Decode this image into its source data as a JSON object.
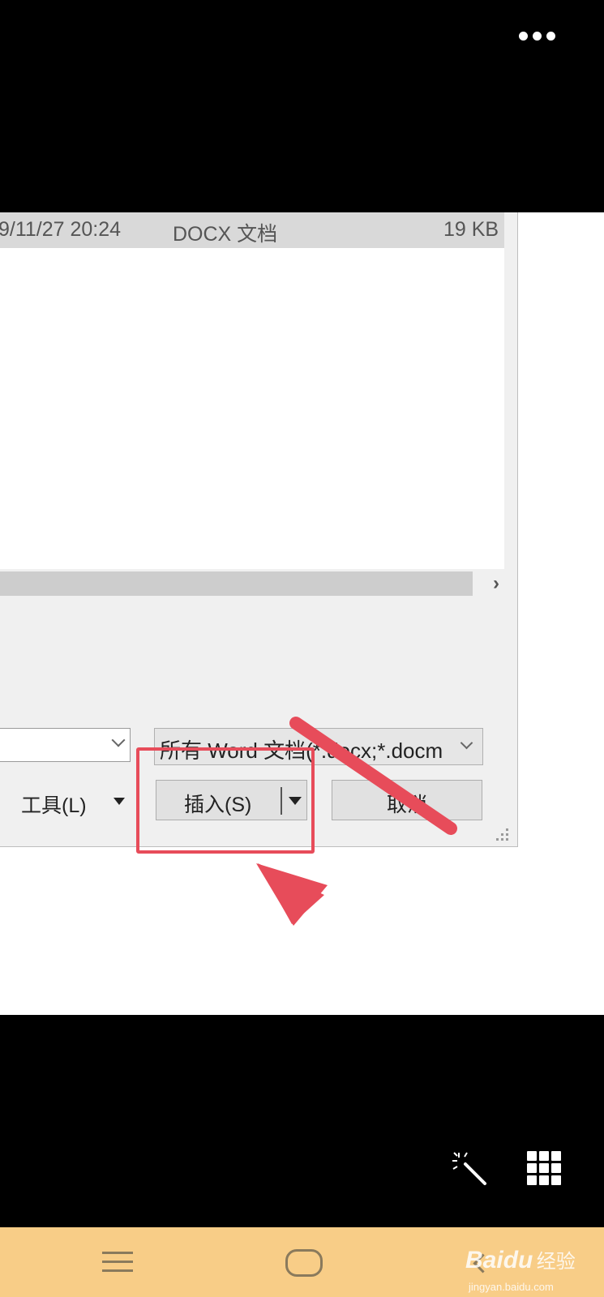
{
  "top_bar": {
    "more_icon": "more-horizontal-icon"
  },
  "file_list": {
    "row": {
      "date": "9/11/27 20:24",
      "type": "DOCX 文档",
      "size": "19 KB"
    }
  },
  "scroll": {
    "right_icon": "chevron-right-icon"
  },
  "dialog": {
    "filename_value": "",
    "filetype_selected": "所有 Word 文档(*.docx;*.docm",
    "tools_label": "工具(L)",
    "insert_label": "插入(S)",
    "cancel_label": "取消"
  },
  "annotation": {
    "highlight_color": "#e74c5a"
  },
  "bottom_bar": {
    "magic_icon": "magic-wand-icon",
    "grid_icon": "grid-apps-icon"
  },
  "nav_bar": {
    "background": "#f8cd87",
    "icons": [
      "menu-icon",
      "home-icon",
      "back-icon"
    ],
    "watermark_logo": "Bai",
    "watermark_logo_tail": "du",
    "watermark_word": "经验",
    "watermark_url": "jingyan.baidu.com"
  }
}
